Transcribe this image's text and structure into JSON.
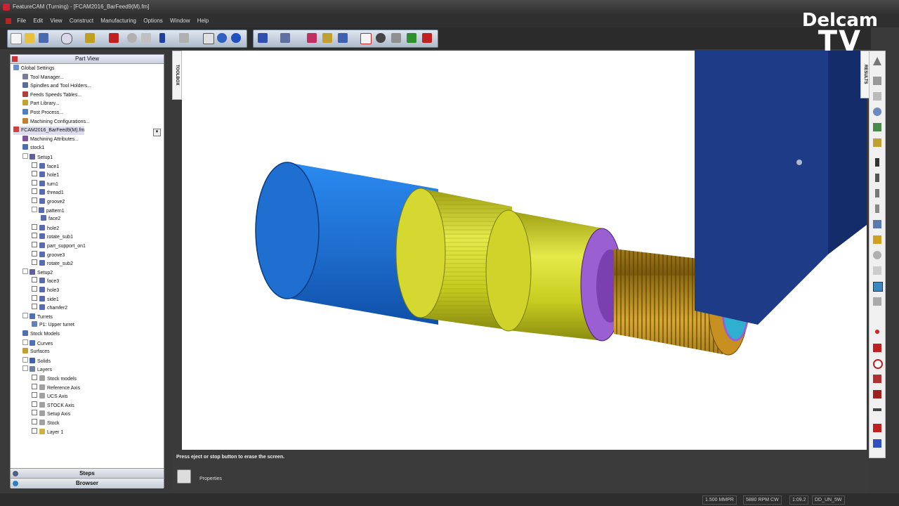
{
  "window": {
    "title": "FeatureCAM (Turning) - [FCAM2016_BarFeed9(M).fm]"
  },
  "menu": [
    "File",
    "Edit",
    "View",
    "Construct",
    "Manufacturing",
    "Options",
    "Window",
    "Help"
  ],
  "watermark": {
    "line1": "Delcam",
    "line2": "TV"
  },
  "panel": {
    "title": "Part View"
  },
  "tree": [
    {
      "label": "Global Settings",
      "indent": 0,
      "icon": "#6a8fd0",
      "kind": "none"
    },
    {
      "label": "Tool Manager...",
      "indent": 1,
      "icon": "#7a7a9a",
      "kind": "none"
    },
    {
      "label": "Spindles and Tool Holders...",
      "indent": 1,
      "icon": "#5b6aa0",
      "kind": "none"
    },
    {
      "label": "Feeds  Speeds Tables...",
      "indent": 1,
      "icon": "#b04040",
      "kind": "none"
    },
    {
      "label": "Part Library...",
      "indent": 1,
      "icon": "#c8a030",
      "kind": "none"
    },
    {
      "label": "Post Process...",
      "indent": 1,
      "icon": "#5080c0",
      "kind": "none"
    },
    {
      "label": "Machining Configurations...",
      "indent": 1,
      "icon": "#c08030",
      "kind": "none"
    },
    {
      "label": "FCAM2016_BarFeed9(M).fm",
      "indent": 0,
      "icon": "#d04040",
      "kind": "none",
      "selected": true
    },
    {
      "label": "Machining Attributes...",
      "indent": 1,
      "icon": "#8050a0",
      "kind": "none"
    },
    {
      "label": "stock1",
      "indent": 1,
      "icon": "#4a70b0",
      "kind": "none"
    },
    {
      "label": "Setup1",
      "indent": 1,
      "icon": "#6060a0",
      "kind": "exp"
    },
    {
      "label": "face1",
      "indent": 2,
      "icon": "#5a6ab0",
      "kind": "cb"
    },
    {
      "label": "hole1",
      "indent": 2,
      "icon": "#5a6ab0",
      "kind": "cb"
    },
    {
      "label": "turn1",
      "indent": 2,
      "icon": "#5a6ab0",
      "kind": "cb"
    },
    {
      "label": "thread1",
      "indent": 2,
      "icon": "#5a6ab0",
      "kind": "cb"
    },
    {
      "label": "groove2",
      "indent": 2,
      "icon": "#5a6ab0",
      "kind": "cb"
    },
    {
      "label": "pattern1",
      "indent": 2,
      "icon": "#5a6ab0",
      "kind": "exp"
    },
    {
      "label": "face2",
      "indent": 3,
      "icon": "#5a6ab0",
      "kind": "none"
    },
    {
      "label": "hole2",
      "indent": 2,
      "icon": "#5a6ab0",
      "kind": "cb"
    },
    {
      "label": "rotate_sub1",
      "indent": 2,
      "icon": "#5a6ab0",
      "kind": "cb"
    },
    {
      "label": "part_support_on1",
      "indent": 2,
      "icon": "#5a6ab0",
      "kind": "cb"
    },
    {
      "label": "groove3",
      "indent": 2,
      "icon": "#5a6ab0",
      "kind": "cb"
    },
    {
      "label": "rotate_sub2",
      "indent": 2,
      "icon": "#5a6ab0",
      "kind": "cb"
    },
    {
      "label": "Setup2",
      "indent": 1,
      "icon": "#6060a0",
      "kind": "exp"
    },
    {
      "label": "face3",
      "indent": 2,
      "icon": "#5a6ab0",
      "kind": "cb"
    },
    {
      "label": "hole3",
      "indent": 2,
      "icon": "#5a6ab0",
      "kind": "cb"
    },
    {
      "label": "side1",
      "indent": 2,
      "icon": "#5a6ab0",
      "kind": "cb"
    },
    {
      "label": "chamfer2",
      "indent": 2,
      "icon": "#5a6ab0",
      "kind": "cb"
    },
    {
      "label": "Turrets",
      "indent": 1,
      "icon": "#5070b0",
      "kind": "exp"
    },
    {
      "label": "P1: Upper turret",
      "indent": 2,
      "icon": "#6080c0",
      "kind": "none"
    },
    {
      "label": "Stock Models",
      "indent": 1,
      "icon": "#5070b0",
      "kind": "none"
    },
    {
      "label": "Curves",
      "indent": 1,
      "icon": "#5070b0",
      "kind": "exp"
    },
    {
      "label": "Surfaces",
      "indent": 1,
      "icon": "#c0a030",
      "kind": "none"
    },
    {
      "label": "Solids",
      "indent": 1,
      "icon": "#4060b0",
      "kind": "exp"
    },
    {
      "label": "Layers",
      "indent": 1,
      "icon": "#7080a0",
      "kind": "exp"
    },
    {
      "label": "Stock models",
      "indent": 2,
      "icon": "#a0a0a0",
      "kind": "cb"
    },
    {
      "label": "Reference Axis",
      "indent": 2,
      "icon": "#a0a0a0",
      "kind": "cb"
    },
    {
      "label": "UCS Axis",
      "indent": 2,
      "icon": "#a0a0a0",
      "kind": "cb"
    },
    {
      "label": "STOCK Axis",
      "indent": 2,
      "icon": "#a0a0a0",
      "kind": "cb"
    },
    {
      "label": "Setup Axis",
      "indent": 2,
      "icon": "#a0a0a0",
      "kind": "cb"
    },
    {
      "label": "Stock",
      "indent": 2,
      "icon": "#a0a0a0",
      "kind": "cb"
    },
    {
      "label": "Layer 1",
      "indent": 2,
      "icon": "#d0b040",
      "kind": "cb"
    }
  ],
  "tabs": {
    "steps": "Steps",
    "browser": "Browser"
  },
  "toolbox_label": "TOOLBOX",
  "right_label": "RESULTS",
  "message": "Press eject or stop button to erase the screen.",
  "properties_label": "Properties",
  "status": [
    "1.500 MMPR",
    "5880 RPM  CW",
    "1:09.2",
    "DD_UN_5W"
  ],
  "colors": {
    "stock_blue": "#1f6fd0",
    "part_yellow": "#c7cc1f",
    "thread_gold": "#b88a1a",
    "groove_purple": "#9a5fd0",
    "turret_navy": "#1d3b86"
  }
}
